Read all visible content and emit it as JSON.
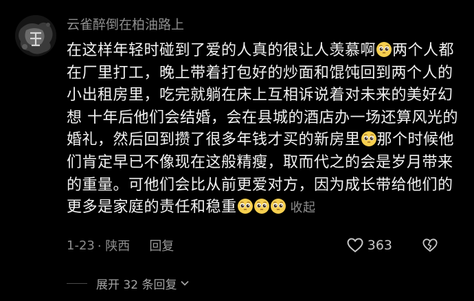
{
  "comment": {
    "username": "云雀醉倒在柏油路上",
    "segments": [
      {
        "text": "在这样年轻时碰到了爱的人真的很让人羡慕啊"
      },
      {
        "emoji": "pleading-face-icon"
      },
      {
        "text": "两个人都在厂里打工，晚上带着打包好的炒面和馄饨回到两个人的小出租房里，吃完就躺在床上互相诉说着对未来的美好幻想  十年后他们会结婚，会在县城的酒店办一场还算风光的婚礼，然后回到攒了很多年钱才买的新房里"
      },
      {
        "emoji": "pleading-face-icon"
      },
      {
        "text": "那个时候他们肯定早已不像现在这般精瘦，取而代之的会是岁月带来的重量。可他们会比从前更爱对方，因为成长带给他们的更多是家庭的责任和稳重"
      },
      {
        "emoji": "pleading-face-icon"
      },
      {
        "emoji": "pleading-face-icon"
      },
      {
        "emoji": "pleading-face-icon"
      }
    ],
    "collapse_label": "收起",
    "date": "1-23",
    "location": "· 陕西",
    "reply_label": "回复",
    "like_count": "363",
    "expand_label": "展开 32 条回复"
  },
  "colors": {
    "background": "#000000",
    "text": "#f2f2f2",
    "muted": "#8e8e8e",
    "emoji_face": "#f6cf4f"
  }
}
